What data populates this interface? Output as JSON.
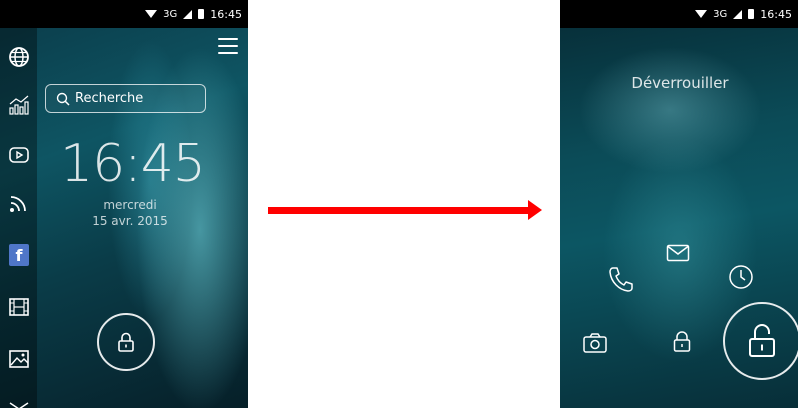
{
  "status_bar": {
    "network": "3G",
    "time": "16:45"
  },
  "left_screen": {
    "sidebar_icons": [
      "globe-icon",
      "stats-icon",
      "video-icon",
      "feed-icon",
      "facebook-icon",
      "film-icon",
      "image-icon"
    ],
    "facebook_letter": "f",
    "search": {
      "label": "Recherche"
    },
    "clock": "16:45",
    "date_day": "mercredi",
    "date_full": "15 avr. 2015"
  },
  "right_screen": {
    "title": "Déverrouiller",
    "shortcuts": [
      "phone-icon",
      "mail-icon",
      "clock-icon",
      "camera-icon",
      "small-lock-icon"
    ]
  },
  "colors": {
    "arrow": "#ff0000",
    "facebook": "#4f76c8",
    "status_bar": "#000000"
  }
}
